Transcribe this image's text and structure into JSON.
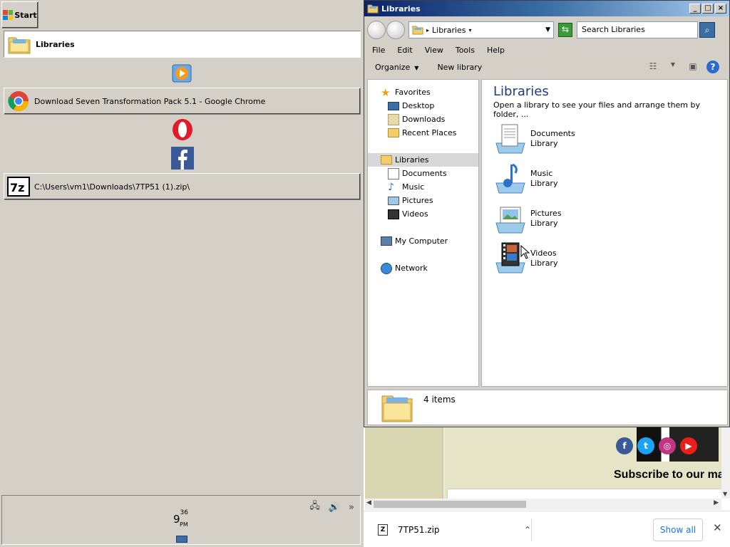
{
  "taskbar": {
    "start_label": "Start",
    "tasks": [
      {
        "label": "Libraries",
        "active": true
      },
      {
        "label": "Download Seven Transformation Pack 5.1 - Google Chrome",
        "active": false
      },
      {
        "label": "C:\\Users\\vm1\\Downloads\\7TP51 (1).zip\\",
        "active": false
      }
    ],
    "quick_launch": [
      "media-player-icon",
      "opera-icon",
      "facebook-icon"
    ],
    "tray": {
      "icons": [
        "network-tray-icon",
        "volume-tray-icon"
      ],
      "expand": "»",
      "clock_hour": "9",
      "clock_minute": "36",
      "clock_ampm": "PM"
    }
  },
  "explorer": {
    "title": "Libraries",
    "window_controls": [
      "_",
      "□",
      "×"
    ],
    "address": "Libraries",
    "search_placeholder": "Search Libraries",
    "menu": [
      "File",
      "Edit",
      "View",
      "Tools",
      "Help"
    ],
    "commands": {
      "organize": "Organize",
      "new_library": "New library"
    },
    "nav": {
      "favorites_label": "Favorites",
      "favorites": [
        "Desktop",
        "Downloads",
        "Recent Places"
      ],
      "libraries_label": "Libraries",
      "libraries": [
        "Documents",
        "Music",
        "Pictures",
        "Videos"
      ],
      "computer_label": "My Computer",
      "network_label": "Network"
    },
    "content": {
      "title": "Libraries",
      "subtitle": "Open a library to see your files and arrange them by folder, ...",
      "items": [
        {
          "name": "Documents",
          "type": "Library"
        },
        {
          "name": "Music",
          "type": "Library"
        },
        {
          "name": "Pictures",
          "type": "Library"
        },
        {
          "name": "Videos",
          "type": "Library"
        }
      ]
    },
    "details": {
      "count": "4 items"
    }
  },
  "browser": {
    "subscribe_text": "Subscribe to our ma",
    "social": [
      "f",
      "t",
      "◎",
      "▶"
    ],
    "download": {
      "file": "7TP51.zip",
      "show_all": "Show all"
    }
  },
  "colors": {
    "title_bar_start": "#0a246a",
    "title_bar_end": "#a6caf0",
    "face": "#d4d0c8",
    "content_title": "#1e3c78",
    "link_blue": "#1a73e8"
  }
}
